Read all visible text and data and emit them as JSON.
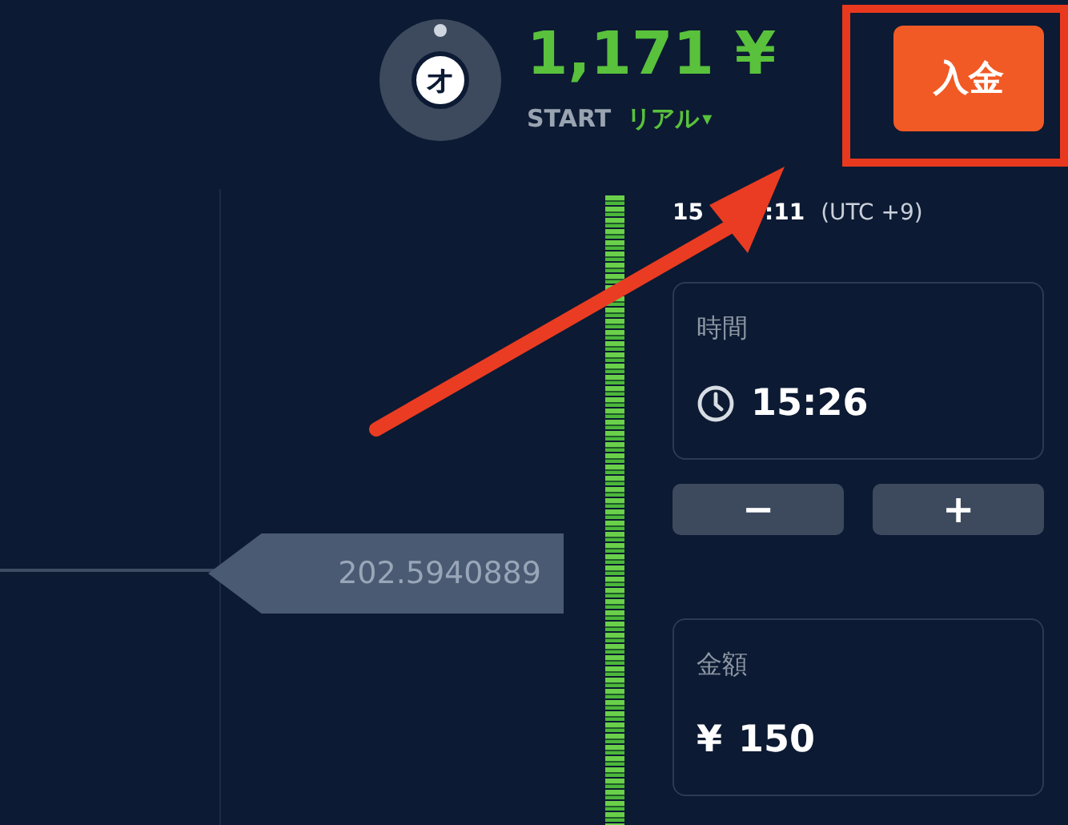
{
  "header": {
    "avatar_letter": "オ",
    "balance": "1,171 ¥",
    "account_level": "START",
    "account_type": "リアル",
    "dropdown_caret": "▾",
    "deposit_button": "入金"
  },
  "chart": {
    "price_tag": "202.5940889"
  },
  "panel": {
    "clock": [
      "15",
      ":11"
    ],
    "timezone": "(UTC +9)",
    "time_field": {
      "label": "時間",
      "value": "15:26"
    },
    "time_buttons": [
      "−",
      "+"
    ],
    "amount_field": {
      "label": "金額",
      "currency": "¥",
      "value": "150"
    }
  }
}
